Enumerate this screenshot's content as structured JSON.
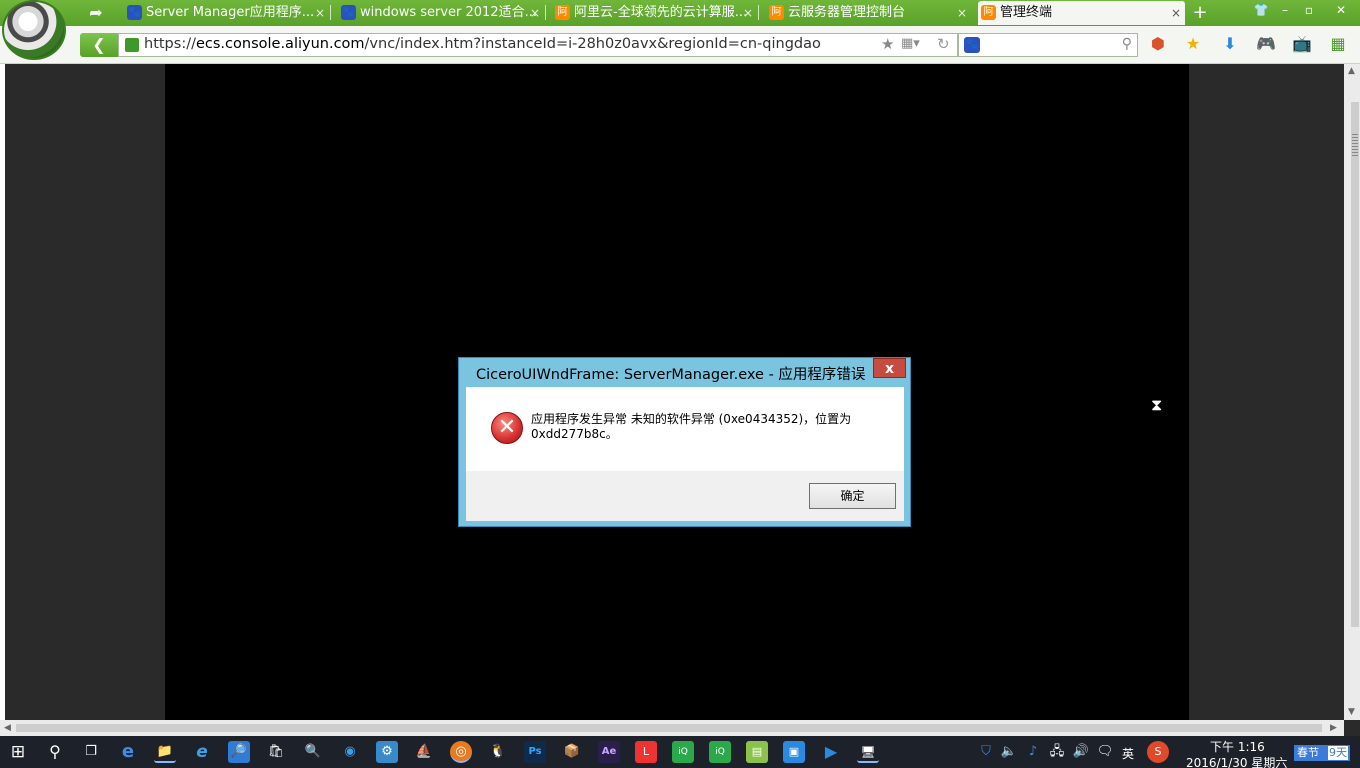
{
  "browser": {
    "tabs": [
      {
        "title": "Server Manager应用程序...",
        "icon": "baidu-paw"
      },
      {
        "title": "windows server 2012适合...",
        "icon": "baidu-paw"
      },
      {
        "title": "阿里云-全球领先的云计算服...",
        "icon": "aliyun"
      },
      {
        "title": "云服务器管理控制台",
        "icon": "aliyun"
      },
      {
        "title": "管理终端",
        "icon": "aliyun",
        "active": true
      }
    ],
    "tab_close": "×",
    "new_tab": "+",
    "url_scheme": "https://",
    "url_host": "ecs.console.aliyun.com",
    "url_path": "/vnc/index.htm?instanceId=i-28h0z0avx&regionId=cn-qingdao",
    "window_controls": {
      "shirt": "👕",
      "minimize": "–",
      "restore": "▫",
      "close": "✕"
    }
  },
  "dialog": {
    "title": "CiceroUIWndFrame: ServerManager.exe - 应用程序错误",
    "close_label": "x",
    "icon_glyph": "✕",
    "message": "应用程序发生异常 未知的软件异常 (0xe0434352)，位置为 0xdd277b8c。",
    "ok_label": "确定"
  },
  "taskbar": {
    "ime": "英",
    "time": "下午 1:16",
    "date": "2016/1/30 星期六",
    "festival_label": "春节",
    "festival_days": "9天"
  },
  "icons": {
    "windows-start": "⊞",
    "search": "⚲",
    "task-view": "❐",
    "edge": "e",
    "explorer": "📁",
    "ie": "e",
    "magnifier": "🔍",
    "store": "🛍",
    "qq": "🐧",
    "photoshop": "Ps",
    "after-effects": "Ae"
  }
}
